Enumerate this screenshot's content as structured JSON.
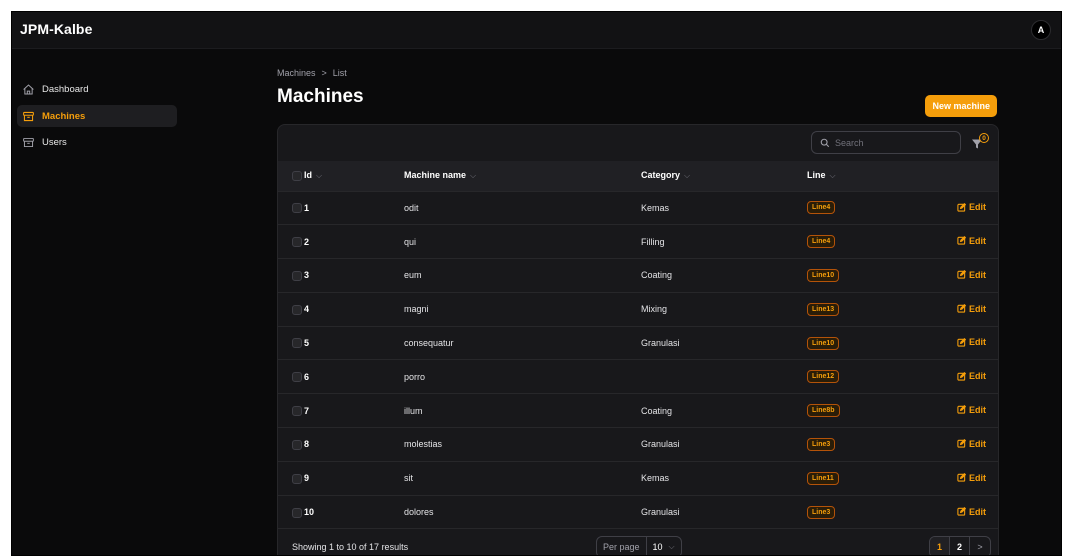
{
  "app": {
    "brand": "JPM-Kalbe",
    "avatar_initial": "A"
  },
  "sidebar": {
    "items": [
      {
        "label": "Dashboard",
        "icon": "home-icon",
        "active": false
      },
      {
        "label": "Machines",
        "icon": "archive-box-icon",
        "active": true
      },
      {
        "label": "Users",
        "icon": "archive-box-icon",
        "active": false
      }
    ]
  },
  "breadcrumb": {
    "items": [
      "Machines",
      "List"
    ],
    "separator": ">"
  },
  "page": {
    "title": "Machines",
    "new_button_label": "New machine"
  },
  "search": {
    "placeholder": "Search",
    "value": ""
  },
  "filter": {
    "active_count": "0"
  },
  "table": {
    "columns": [
      "Id",
      "Machine name",
      "Category",
      "Line"
    ],
    "edit_label": "Edit",
    "rows": [
      {
        "id": "1",
        "name": "odit",
        "category": "Kemas",
        "line": "Line4"
      },
      {
        "id": "2",
        "name": "qui",
        "category": "Filling",
        "line": "Line4"
      },
      {
        "id": "3",
        "name": "eum",
        "category": "Coating",
        "line": "Line10"
      },
      {
        "id": "4",
        "name": "magni",
        "category": "Mixing",
        "line": "Line13"
      },
      {
        "id": "5",
        "name": "consequatur",
        "category": "Granulasi",
        "line": "Line10"
      },
      {
        "id": "6",
        "name": "porro",
        "category": "",
        "line": "Line12"
      },
      {
        "id": "7",
        "name": "illum",
        "category": "Coating",
        "line": "Line8b"
      },
      {
        "id": "8",
        "name": "molestias",
        "category": "Granulasi",
        "line": "Line3"
      },
      {
        "id": "9",
        "name": "sit",
        "category": "Kemas",
        "line": "Line11"
      },
      {
        "id": "10",
        "name": "dolores",
        "category": "Granulasi",
        "line": "Line3"
      }
    ]
  },
  "footer": {
    "results_text": "Showing 1 to 10 of 17 results",
    "per_page_label": "Per page",
    "per_page_value": "10",
    "pages": [
      "1",
      "2"
    ],
    "current_page": "1",
    "next_symbol": ">"
  },
  "colors": {
    "accent": "#f59e0b",
    "background": "#0a0a0b",
    "card": "#18181b"
  }
}
